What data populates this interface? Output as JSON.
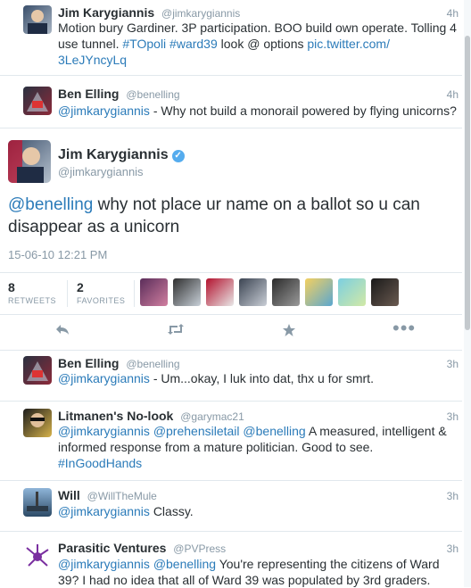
{
  "tweets_above": [
    {
      "name": "Jim Karygiannis",
      "handle": "@jimkarygiannis",
      "time": "4h",
      "text_plain": "Motion bury Gardiner. 3P participation. BOO build own operate. Tolling 4 use tunnel.",
      "text_tags": "#TOpoli #ward39",
      "text_mid": "look @ options",
      "text_link": "pic.twitter.com/ 3LeJYncyLq"
    },
    {
      "name": "Ben Elling",
      "handle": "@benelling",
      "time": "4h",
      "mention": "@jimkarygiannis",
      "text": "- Why not build a monorail powered by flying unicorns?"
    }
  ],
  "focused": {
    "name": "Jim Karygiannis",
    "handle": "@jimkarygiannis",
    "mention": "@benelling",
    "text": "why not place ur name on a ballot so u can disappear as a unicorn",
    "timestamp": "15-06-10 12:21 PM",
    "retweets_count": "8",
    "retweets_label": "RETWEETS",
    "favorites_count": "2",
    "favorites_label": "FAVORITES"
  },
  "icons": [
    "reply-icon",
    "retweet-icon",
    "favorite-icon",
    "more-icon",
    "verified-icon"
  ],
  "replies": [
    {
      "name": "Ben Elling",
      "handle": "@benelling",
      "time": "3h",
      "mention": "@jimkarygiannis",
      "text": "- Um...okay, I luk into dat, thx u for smrt."
    },
    {
      "name": "Litmanen's No-look",
      "handle": "@garymac21",
      "time": "3h",
      "mention1": "@jimkarygiannis",
      "mention2": "@prehensiletail",
      "mention3": "@benelling",
      "text": "A measured, intelligent & informed response from a mature politician. Good to see.",
      "tag": "#InGoodHands"
    },
    {
      "name": "Will",
      "handle": "@WillTheMule",
      "time": "3h",
      "mention": "@jimkarygiannis",
      "text": "Classy."
    },
    {
      "name": "Parasitic Ventures",
      "handle": "@PVPress",
      "time": "3h",
      "mention1": "@jimkarygiannis",
      "mention2": "@benelling",
      "text": "You're representing the citizens of Ward 39? I had no idea that all of Ward 39 was populated by 3rd graders."
    }
  ],
  "colors": {
    "link": "#2b7bb9",
    "muted": "#8899a6",
    "border": "#e1e8ed",
    "verified": "#55acee"
  }
}
